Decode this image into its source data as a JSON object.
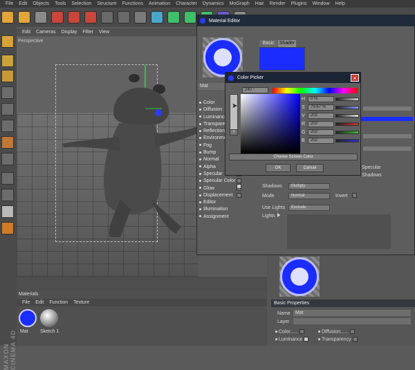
{
  "menubar": {
    "items": [
      "File",
      "Edit",
      "Objects",
      "Tools",
      "Selection",
      "Structure",
      "Functions",
      "Animation",
      "Character",
      "Dynamics",
      "MoGraph",
      "Hair",
      "Render",
      "Plugins",
      "Window",
      "Help"
    ]
  },
  "viewport": {
    "menu": [
      "Edit",
      "Cameras",
      "Display",
      "Filter",
      "View"
    ],
    "title": "Perspective"
  },
  "materials": {
    "title": "Materials",
    "menu": [
      "File",
      "Edit",
      "Function",
      "Texture"
    ],
    "swatches": [
      {
        "label": "Mat"
      },
      {
        "label": "Sketch 1"
      }
    ]
  },
  "material_editor": {
    "title": "Material Editor",
    "tabs": [
      "Basic",
      "Shader"
    ],
    "name_field": "Mat",
    "channels": [
      "Color",
      "Diffusion",
      "Luminance",
      "Transparency",
      "Reflection",
      "Environment",
      "Fog",
      "Bump",
      "Normal",
      "Alpha",
      "Specular",
      "Specular Color",
      "Glow",
      "Displacement",
      "Editor",
      "Illumination",
      "Assignment"
    ],
    "checked_channels": [
      "Luminance",
      "Specular"
    ],
    "right_labels": {
      "specular": "Specular",
      "shadows": "Shadows",
      "shadows_label": "Shadows",
      "shadows_value": "Multiply",
      "mode_label": "Mode",
      "mode_value": "Normal",
      "invert_label": "Invert",
      "use_lights_label": "Use Lights",
      "use_lights_value": "Exclude",
      "lights_label": "Lights"
    }
  },
  "color_picker": {
    "title": "Color Picker",
    "hue_value": "240 °",
    "fields": [
      {
        "label": "H",
        "value": "0 %"
      },
      {
        "label": "S",
        "value": "79.67 %"
      },
      {
        "label": "V",
        "value": "202"
      },
      {
        "label": "R",
        "value": "202"
      },
      {
        "label": "G",
        "value": "202"
      },
      {
        "label": "B",
        "value": "202"
      }
    ],
    "choose_screen_color": "Choose Screen Color",
    "ok": "OK",
    "cancel": "Cancel",
    "add_button": "+"
  },
  "attributes": {
    "header": "Basic Properties",
    "name_label": "Name",
    "name_value": "Mat",
    "layer_label": "Layer",
    "channels": [
      {
        "label": "Color......",
        "checked": false
      },
      {
        "label": "Diffusion......",
        "checked": false
      },
      {
        "label": "Luminance",
        "checked": true
      },
      {
        "label": "Transparency",
        "checked": false
      }
    ]
  },
  "branding": {
    "maxon": "MAXON CINEMA 4D"
  },
  "colors": {
    "accent_blue": "#1b2cff",
    "title_bar": "#1f2a3a",
    "close_red": "#c43a2e"
  }
}
